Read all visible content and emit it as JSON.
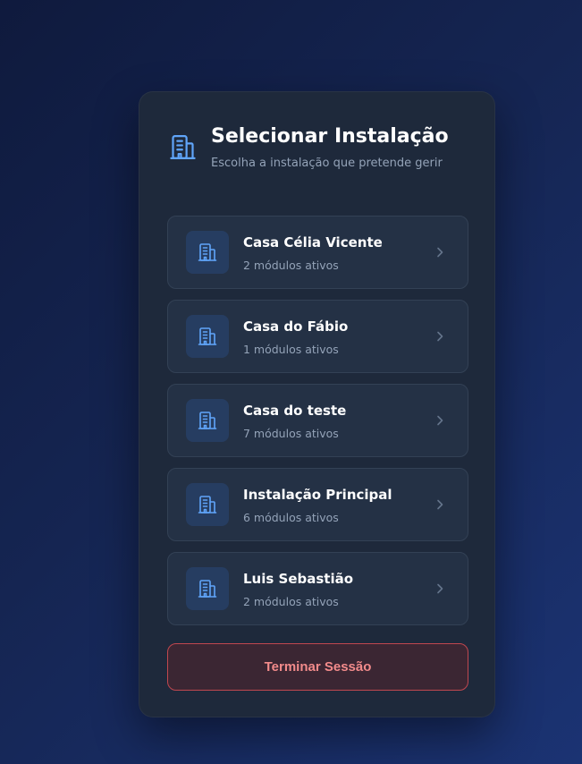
{
  "header": {
    "icon": "building-icon",
    "title": "Selecionar Instalação",
    "subtitle": "Escolha a instalação que pretende gerir"
  },
  "installations": [
    {
      "name": "Casa Célia Vicente",
      "modules": "2 módulos ativos",
      "icon": "building-icon"
    },
    {
      "name": "Casa do Fábio",
      "modules": "1 módulos ativos",
      "icon": "building-icon"
    },
    {
      "name": "Casa do teste",
      "modules": "7 módulos ativos",
      "icon": "building-icon"
    },
    {
      "name": "Instalação Principal",
      "modules": "6 módulos ativos",
      "icon": "building-icon"
    },
    {
      "name": "Luis Sebastião",
      "modules": "2 módulos ativos",
      "icon": "building-icon"
    }
  ],
  "logout": {
    "label": "Terminar Sessão"
  },
  "colors": {
    "accent": "#60a5fa",
    "danger": "#f28b8b",
    "card": "#1e293b"
  }
}
